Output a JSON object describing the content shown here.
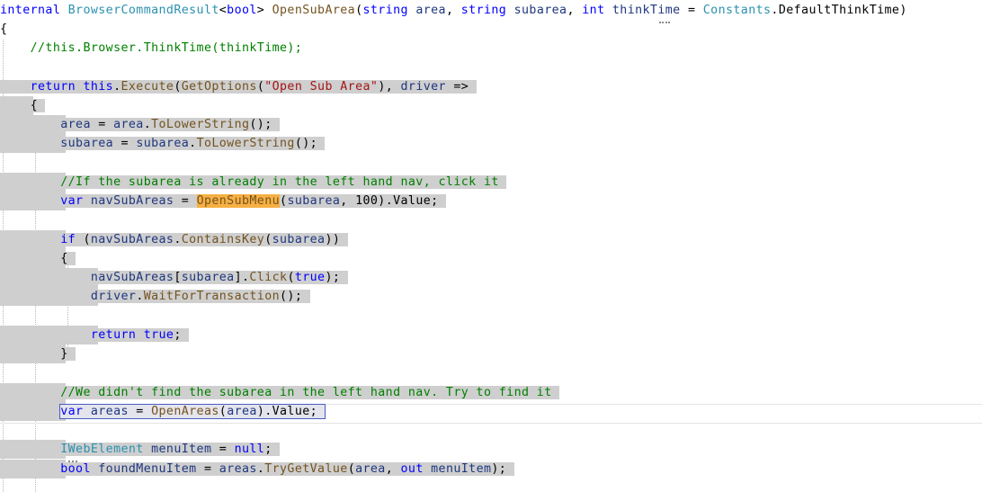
{
  "editor": {
    "lines": [
      {
        "parts": [
          {
            "c": "kw",
            "t": "internal"
          },
          {
            "c": "plain",
            "t": " "
          },
          {
            "c": "ty",
            "t": "BrowserCommandResult"
          },
          {
            "c": "plain",
            "t": "<"
          },
          {
            "c": "kw",
            "t": "bool"
          },
          {
            "c": "plain",
            "t": "> "
          },
          {
            "c": "mt",
            "t": "OpenSubArea"
          },
          {
            "c": "plain",
            "t": "("
          },
          {
            "c": "kw",
            "t": "string"
          },
          {
            "c": "plain",
            "t": " "
          },
          {
            "c": "id",
            "t": "area"
          },
          {
            "c": "plain",
            "t": ", "
          },
          {
            "c": "kw",
            "t": "string"
          },
          {
            "c": "plain",
            "t": " "
          },
          {
            "c": "id",
            "t": "subarea"
          },
          {
            "c": "plain",
            "t": ", "
          },
          {
            "c": "kw",
            "t": "int"
          },
          {
            "c": "plain",
            "t": " "
          },
          {
            "c": "id",
            "t": "thinkTime"
          },
          {
            "c": "plain",
            "t": " = "
          },
          {
            "c": "ty",
            "t": "Constants"
          },
          {
            "c": "plain",
            "t": ".DefaultThinkTime)"
          }
        ]
      },
      {
        "parts": [
          {
            "c": "plain",
            "t": "{"
          }
        ]
      },
      {
        "parts": [
          {
            "c": "cm",
            "t": "    //this.Browser.ThinkTime(thinkTime);"
          }
        ]
      },
      {
        "parts": []
      },
      {
        "parts": [
          {
            "c": "plain",
            "t": "    "
          },
          {
            "c": "kw",
            "t": "return"
          },
          {
            "c": "plain",
            "t": " "
          },
          {
            "c": "kw",
            "t": "this"
          },
          {
            "c": "plain",
            "t": "."
          },
          {
            "c": "mt",
            "t": "Execute"
          },
          {
            "c": "plain",
            "t": "("
          },
          {
            "c": "mt",
            "t": "GetOptions"
          },
          {
            "c": "plain",
            "t": "("
          },
          {
            "c": "str",
            "t": "\"Open Sub Area\""
          },
          {
            "c": "plain",
            "t": "), "
          },
          {
            "c": "id",
            "t": "driver"
          },
          {
            "c": "plain",
            "t": " =>"
          }
        ]
      },
      {
        "parts": [
          {
            "c": "plain",
            "t": "    {"
          }
        ]
      },
      {
        "parts": [
          {
            "c": "plain",
            "t": "        "
          },
          {
            "c": "id",
            "t": "area"
          },
          {
            "c": "plain",
            "t": " = "
          },
          {
            "c": "id",
            "t": "area"
          },
          {
            "c": "plain",
            "t": "."
          },
          {
            "c": "mt",
            "t": "ToLowerString"
          },
          {
            "c": "plain",
            "t": "();"
          }
        ]
      },
      {
        "parts": [
          {
            "c": "plain",
            "t": "        "
          },
          {
            "c": "id",
            "t": "subarea"
          },
          {
            "c": "plain",
            "t": " = "
          },
          {
            "c": "id",
            "t": "subarea"
          },
          {
            "c": "plain",
            "t": "."
          },
          {
            "c": "mt",
            "t": "ToLowerString"
          },
          {
            "c": "plain",
            "t": "();"
          }
        ]
      },
      {
        "parts": []
      },
      {
        "parts": [
          {
            "c": "cm",
            "t": "        //If the subarea is already in the left hand nav, click it"
          }
        ]
      },
      {
        "parts": [
          {
            "c": "plain",
            "t": "        "
          },
          {
            "c": "kw",
            "t": "var"
          },
          {
            "c": "plain",
            "t": " "
          },
          {
            "c": "id",
            "t": "navSubAreas"
          },
          {
            "c": "plain",
            "t": " = "
          },
          {
            "c": "mt ref",
            "t": "OpenSubMenu"
          },
          {
            "c": "plain",
            "t": "("
          },
          {
            "c": "id",
            "t": "subarea"
          },
          {
            "c": "plain",
            "t": ", 100).Value;"
          }
        ]
      },
      {
        "parts": []
      },
      {
        "parts": [
          {
            "c": "plain",
            "t": "        "
          },
          {
            "c": "kw",
            "t": "if"
          },
          {
            "c": "plain",
            "t": " ("
          },
          {
            "c": "id",
            "t": "navSubAreas"
          },
          {
            "c": "plain",
            "t": "."
          },
          {
            "c": "mt",
            "t": "ContainsKey"
          },
          {
            "c": "plain",
            "t": "("
          },
          {
            "c": "id",
            "t": "subarea"
          },
          {
            "c": "plain",
            "t": "))"
          }
        ]
      },
      {
        "parts": [
          {
            "c": "plain",
            "t": "        {"
          }
        ]
      },
      {
        "parts": [
          {
            "c": "plain",
            "t": "            "
          },
          {
            "c": "id",
            "t": "navSubAreas"
          },
          {
            "c": "plain",
            "t": "["
          },
          {
            "c": "id",
            "t": "subarea"
          },
          {
            "c": "plain",
            "t": "]."
          },
          {
            "c": "mt",
            "t": "Click"
          },
          {
            "c": "plain",
            "t": "("
          },
          {
            "c": "kw",
            "t": "true"
          },
          {
            "c": "plain",
            "t": ");"
          }
        ]
      },
      {
        "parts": [
          {
            "c": "plain",
            "t": "            "
          },
          {
            "c": "id",
            "t": "driver"
          },
          {
            "c": "plain",
            "t": "."
          },
          {
            "c": "mt",
            "t": "WaitForTransaction"
          },
          {
            "c": "plain",
            "t": "();"
          }
        ]
      },
      {
        "parts": []
      },
      {
        "parts": [
          {
            "c": "plain",
            "t": "            "
          },
          {
            "c": "kw",
            "t": "return"
          },
          {
            "c": "plain",
            "t": " "
          },
          {
            "c": "kw",
            "t": "true"
          },
          {
            "c": "plain",
            "t": ";"
          }
        ]
      },
      {
        "parts": [
          {
            "c": "plain",
            "t": "        }"
          }
        ]
      },
      {
        "parts": []
      },
      {
        "parts": [
          {
            "c": "cm",
            "t": "        //We didn't find the subarea in the left hand nav. Try to find it"
          }
        ]
      },
      {
        "parts": [
          {
            "c": "plain",
            "t": "        "
          },
          {
            "c": "kw",
            "t": "var"
          },
          {
            "c": "plain",
            "t": " "
          },
          {
            "c": "id",
            "t": "areas"
          },
          {
            "c": "plain",
            "t": " = "
          },
          {
            "c": "mt",
            "t": "OpenAreas"
          },
          {
            "c": "plain",
            "t": "("
          },
          {
            "c": "id",
            "t": "area"
          },
          {
            "c": "plain",
            "t": ")."
          },
          {
            "c": "plain",
            "t": "Value;"
          }
        ]
      },
      {
        "parts": []
      },
      {
        "parts": [
          {
            "c": "plain",
            "t": "        "
          },
          {
            "c": "ty",
            "t": "IWebElement"
          },
          {
            "c": "plain",
            "t": " "
          },
          {
            "c": "id",
            "t": "menuItem"
          },
          {
            "c": "plain",
            "t": " = "
          },
          {
            "c": "kw",
            "t": "null"
          },
          {
            "c": "plain",
            "t": ";"
          }
        ]
      },
      {
        "parts": [
          {
            "c": "plain",
            "t": "        "
          },
          {
            "c": "kw",
            "t": "bool"
          },
          {
            "c": "plain",
            "t": " "
          },
          {
            "c": "id",
            "t": "foundMenuItem"
          },
          {
            "c": "plain",
            "t": " = "
          },
          {
            "c": "id",
            "t": "areas"
          },
          {
            "c": "plain",
            "t": "."
          },
          {
            "c": "mt",
            "t": "TryGetValue"
          },
          {
            "c": "plain",
            "t": "("
          },
          {
            "c": "id",
            "t": "area"
          },
          {
            "c": "plain",
            "t": ", "
          },
          {
            "c": "kw",
            "t": "out"
          },
          {
            "c": "plain",
            "t": " "
          },
          {
            "c": "id",
            "t": "menuItem"
          },
          {
            "c": "plain",
            "t": ");"
          }
        ]
      }
    ]
  }
}
